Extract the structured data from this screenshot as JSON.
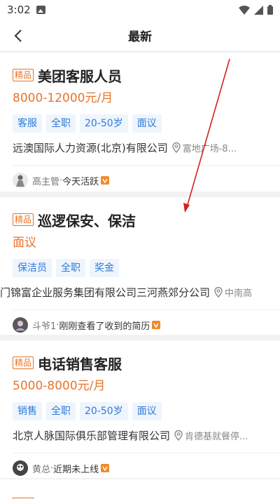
{
  "status_bar": {
    "time": "3:02"
  },
  "header": {
    "title": "最新"
  },
  "jobs": [
    {
      "badge": "精品",
      "title": "美团客服人员",
      "salary": "8000-12000元/月",
      "tags": [
        "客服",
        "全职",
        "20-50岁",
        "面议"
      ],
      "company": "远澳国际人力资源(北京)有限公司",
      "location": "富地广场-8...",
      "recruiter_name": "高主管",
      "recruiter_sep": "·",
      "recruiter_status": "今天活跃"
    },
    {
      "badge": "精品",
      "title": "巡逻保安、保洁",
      "salary": "面议",
      "tags": [
        "保洁员",
        "全职",
        "奖金"
      ],
      "company": "门锦富企业服务集团有限公司三河燕郊分公司",
      "location": "中南高",
      "recruiter_name": "斗爷1",
      "recruiter_sep": "·",
      "recruiter_status": "刚刚查看了收到的简历"
    },
    {
      "badge": "精品",
      "title": "电话销售客服",
      "salary": "5000-8000元/月",
      "tags": [
        "销售",
        "全职",
        "20-50岁",
        "面议"
      ],
      "company": "北京人脉国际俱乐部管理有限公司",
      "location": "肯德基就餐停...",
      "recruiter_name": "黄总",
      "recruiter_sep": "·",
      "recruiter_status": "近期未上线"
    }
  ],
  "colors": {
    "accent": "#e8742a",
    "tag_text": "#2f7bd6",
    "tag_bg": "#eef5fd",
    "annotation_arrow": "#d42020"
  }
}
